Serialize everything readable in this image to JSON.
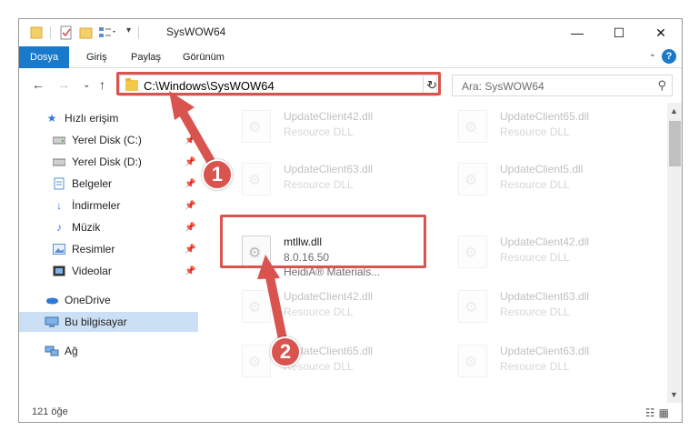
{
  "window": {
    "title": "SysWOW64",
    "minimize": "—",
    "maximize": "☐",
    "close": "✕"
  },
  "ribbon": {
    "tabs": [
      "Dosya",
      "Giriş",
      "Paylaş",
      "Görünüm"
    ],
    "help": "?"
  },
  "address": {
    "path": "C:\\Windows\\SysWOW64",
    "search_placeholder": "Ara: SysWOW64"
  },
  "navpane": {
    "quick_access": "Hızlı erişim",
    "items": [
      {
        "label": "Yerel Disk (C:)",
        "icon": "drive-icon",
        "pinned": true
      },
      {
        "label": "Yerel Disk (D:)",
        "icon": "drive-icon",
        "pinned": true
      },
      {
        "label": "Belgeler",
        "icon": "documents-icon",
        "pinned": true
      },
      {
        "label": "İndirmeler",
        "icon": "download-icon",
        "pinned": true
      },
      {
        "label": "Müzik",
        "icon": "music-icon",
        "pinned": true
      },
      {
        "label": "Resimler",
        "icon": "pictures-icon",
        "pinned": true
      },
      {
        "label": "Videolar",
        "icon": "videos-icon",
        "pinned": true
      }
    ],
    "onedrive": "OneDrive",
    "this_pc": "Bu bilgisayar",
    "network": "Ağ"
  },
  "files": {
    "highlighted": {
      "name": "mtllw.dll",
      "version": "8.0.16.50",
      "company": "HeidiA® Materials..."
    },
    "faded": [
      {
        "name": "UpdateClient42.dll",
        "desc": "Resource DLL"
      },
      {
        "name": "UpdateClient65.dll",
        "desc": "Resource DLL"
      },
      {
        "name": "UpdateClient63.dll",
        "desc": "Resource DLL"
      },
      {
        "name": "UpdateClient5.dll",
        "desc": "Resource DLL"
      },
      {
        "name": "UpdateClient42.dll",
        "desc": "Resource DLL"
      },
      {
        "name": "UpdateClient63.dll",
        "desc": "Resource DLL"
      },
      {
        "name": "UpdateClient42.dll",
        "desc": "Resource DLL"
      },
      {
        "name": "UpdateClient63.dll",
        "desc": "Resource DLL"
      },
      {
        "name": "UpdateClient65.dll",
        "desc": "Resource DLL"
      },
      {
        "name": "UpdateClient63.dll",
        "desc": "Resource DLL"
      }
    ]
  },
  "status": {
    "count": "121 öğe"
  },
  "annotations": {
    "step1": "1",
    "step2": "2",
    "color": "#d9534f"
  }
}
